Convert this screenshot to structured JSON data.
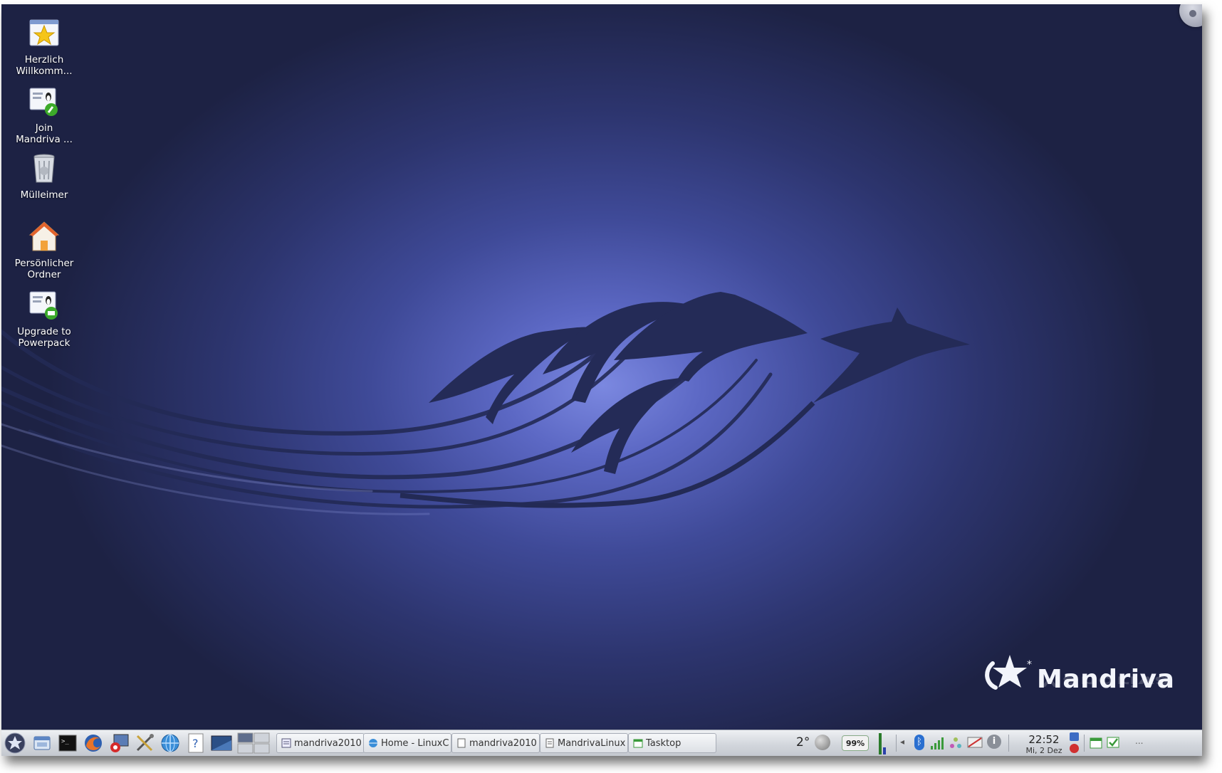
{
  "desktop": {
    "icons": [
      {
        "label": "Herzlich\nWillkomm...",
        "icon": "welcome-star-icon"
      },
      {
        "label": "Join\nMandriva ...",
        "icon": "join-mandriva-icon"
      },
      {
        "label": "Mülleimer",
        "icon": "trash-icon"
      },
      {
        "label": "Persönlicher\nOrdner",
        "icon": "home-folder-icon"
      },
      {
        "label": "Upgrade to\nPowerpack",
        "icon": "upgrade-powerpack-icon"
      }
    ],
    "logo_text": "Mandriva"
  },
  "taskbar": {
    "launchers": [
      "start-menu-icon",
      "file-manager-icon",
      "terminal-icon",
      "firefox-icon",
      "system-config-icon",
      "tools-icon",
      "web-browser-icon",
      "help-icon",
      "desktop-preview-icon",
      "pager-icon"
    ],
    "tasks": [
      {
        "label": "mandriva2010",
        "icon": "document-icon"
      },
      {
        "label": "Home - LinuxC",
        "icon": "browser-icon"
      },
      {
        "label": "mandriva2010",
        "icon": "document-icon"
      },
      {
        "label": "MandrivaLinux",
        "icon": "document-icon"
      },
      {
        "label": "Tasktop",
        "icon": "calendar-icon"
      }
    ],
    "weather": "2°",
    "battery": "99%",
    "tray_icons": [
      "expand-arrow-icon",
      "bluetooth-icon",
      "network-signal-icon",
      "sharing-icon",
      "monitor-icon",
      "info-icon"
    ],
    "clock": {
      "time": "22:52",
      "date": "Mi, 2 Dez"
    },
    "more": "..."
  },
  "colors": {
    "wallpaper_center": "#7b88e0",
    "wallpaper_edge": "#1d2244",
    "taskbar": "#d3d7dd"
  }
}
